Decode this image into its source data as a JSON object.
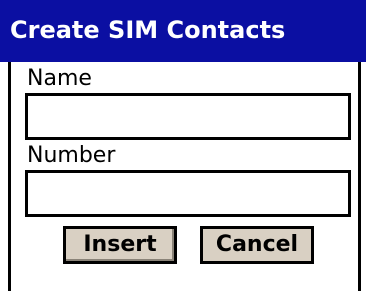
{
  "window": {
    "title": "Create SIM Contacts"
  },
  "form": {
    "name_label": "Name",
    "name_value": "",
    "number_label": "Number",
    "number_value": ""
  },
  "buttons": {
    "insert_label": "Insert",
    "cancel_label": "Cancel"
  },
  "colors": {
    "titlebar": "#0b0fa2",
    "button_face": "#d9d0c3"
  }
}
